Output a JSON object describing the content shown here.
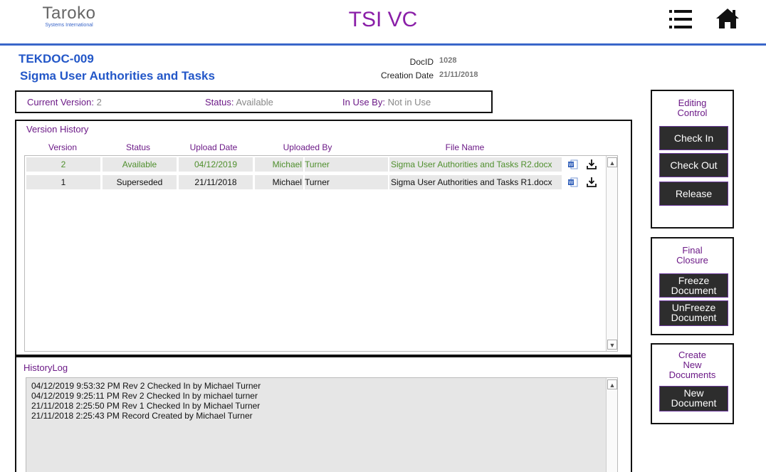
{
  "header": {
    "logo_main": "Taroko",
    "logo_sub": "Systems International",
    "app_title": "TSI VC"
  },
  "document": {
    "code": "TEKDOC-009",
    "title": "Sigma User Authorities and Tasks",
    "docid_label": "DocID",
    "docid_value": "1028",
    "creation_label": "Creation Date",
    "creation_value": "21/11/2018"
  },
  "version_bar": {
    "current_label": "Current Version:",
    "current_value": "2",
    "status_label": "Status:",
    "status_value": "Available",
    "inuse_label": "In Use By:",
    "inuse_value": "Not in Use"
  },
  "version_history": {
    "title": "Version History",
    "columns": [
      "Version",
      "Status",
      "Upload Date",
      "Uploaded By",
      "File Name"
    ],
    "rows": [
      {
        "version": "2",
        "status": "Available",
        "upload_date": "04/12/2019",
        "first": "Michael",
        "last": "Turner",
        "file_name": "Sigma User Authorities and Tasks R2.docx"
      },
      {
        "version": "1",
        "status": "Superseded",
        "upload_date": "21/11/2018",
        "first": "Michael",
        "last": "Turner",
        "file_name": "Sigma User Authorities and Tasks R1.docx"
      }
    ]
  },
  "history_log": {
    "title": "HistoryLog",
    "lines": [
      "04/12/2019 9:53:32 PM Rev 2 Checked In by Michael Turner",
      "04/12/2019 9:25:11 PM Rev 2 Checked In by michael turner",
      "21/11/2018 2:25:50 PM Rev 1 Checked In by Michael Turner",
      "21/11/2018 2:25:43 PM Record Created by Michael Turner"
    ]
  },
  "editing_control": {
    "title_line1": "Editing",
    "title_line2": "Control",
    "check_in": "Check In",
    "check_out": "Check Out",
    "release": "Release"
  },
  "final_closure": {
    "title_line1": "Final",
    "title_line2": "Closure",
    "freeze_line1": "Freeze",
    "freeze_line2": "Document",
    "unfreeze_line1": "UnFreeze",
    "unfreeze_line2": "Document"
  },
  "create_new": {
    "title_line1": "Create",
    "title_line2": "New",
    "title_line3": "Documents",
    "new_line1": "New",
    "new_line2": "Document"
  },
  "icons": {
    "menu": "hamburger-menu-icon",
    "home": "home-icon",
    "word": "word-document-icon",
    "download": "download-icon"
  },
  "colors": {
    "accent_blue": "#2357c8",
    "purple": "#6c1a87",
    "title_purple": "#8a1fa8",
    "available_green": "#4f8f2d",
    "button_dark": "#2d2d2d"
  }
}
